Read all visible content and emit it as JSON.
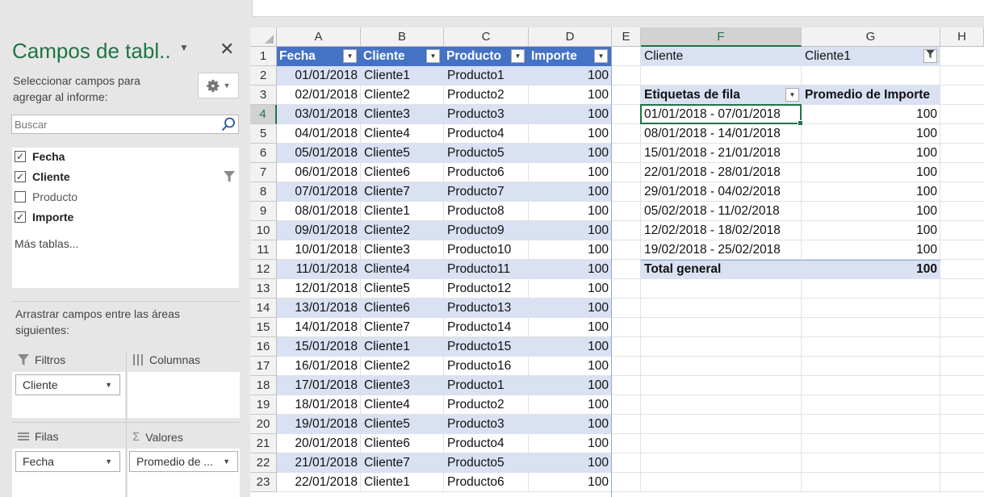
{
  "pane": {
    "title": "Campos de tabl..",
    "instructions": "Seleccionar campos para agregar al informe:",
    "search_placeholder": "Buscar",
    "fields": [
      {
        "label": "Fecha",
        "checked": true
      },
      {
        "label": "Cliente",
        "checked": true
      },
      {
        "label": "Producto",
        "checked": false
      },
      {
        "label": "Importe",
        "checked": true
      }
    ],
    "more_tables": "Más tablas...",
    "drag_instructions": "Arrastrar campos entre las áreas siguientes:",
    "areas": {
      "filters_label": "Filtros",
      "columns_label": "Columnas",
      "rows_label": "Filas",
      "values_label": "Valores",
      "filter_item": "Cliente",
      "row_item": "Fecha",
      "value_item": "Promedio de ..."
    }
  },
  "sheet": {
    "columns": [
      "A",
      "B",
      "C",
      "D",
      "E",
      "F",
      "G",
      "H"
    ],
    "selected_column": "F",
    "selected_row": 4,
    "rows": [
      1,
      2,
      3,
      4,
      5,
      6,
      7,
      8,
      9,
      10,
      11,
      12,
      13,
      14,
      15,
      16,
      17,
      18,
      19,
      20,
      21,
      22,
      23
    ],
    "table_headers": [
      "Fecha",
      "Cliente",
      "Producto",
      "Importe"
    ],
    "table_rows": [
      [
        "01/01/2018",
        "Cliente1",
        "Producto1",
        "100"
      ],
      [
        "02/01/2018",
        "Cliente2",
        "Producto2",
        "100"
      ],
      [
        "03/01/2018",
        "Cliente3",
        "Producto3",
        "100"
      ],
      [
        "04/01/2018",
        "Cliente4",
        "Producto4",
        "100"
      ],
      [
        "05/01/2018",
        "Cliente5",
        "Producto5",
        "100"
      ],
      [
        "06/01/2018",
        "Cliente6",
        "Producto6",
        "100"
      ],
      [
        "07/01/2018",
        "Cliente7",
        "Producto7",
        "100"
      ],
      [
        "08/01/2018",
        "Cliente1",
        "Producto8",
        "100"
      ],
      [
        "09/01/2018",
        "Cliente2",
        "Producto9",
        "100"
      ],
      [
        "10/01/2018",
        "Cliente3",
        "Producto10",
        "100"
      ],
      [
        "11/01/2018",
        "Cliente4",
        "Producto11",
        "100"
      ],
      [
        "12/01/2018",
        "Cliente5",
        "Producto12",
        "100"
      ],
      [
        "13/01/2018",
        "Cliente6",
        "Producto13",
        "100"
      ],
      [
        "14/01/2018",
        "Cliente7",
        "Producto14",
        "100"
      ],
      [
        "15/01/2018",
        "Cliente1",
        "Producto15",
        "100"
      ],
      [
        "16/01/2018",
        "Cliente2",
        "Producto16",
        "100"
      ],
      [
        "17/01/2018",
        "Cliente3",
        "Producto1",
        "100"
      ],
      [
        "18/01/2018",
        "Cliente4",
        "Producto2",
        "100"
      ],
      [
        "19/01/2018",
        "Cliente5",
        "Producto3",
        "100"
      ],
      [
        "20/01/2018",
        "Cliente6",
        "Producto4",
        "100"
      ],
      [
        "21/01/2018",
        "Cliente7",
        "Producto5",
        "100"
      ],
      [
        "22/01/2018",
        "Cliente1",
        "Producto6",
        "100"
      ]
    ]
  },
  "pivot": {
    "filter_field": "Cliente",
    "filter_value": "Cliente1",
    "row_header": "Etiquetas de fila",
    "value_header": "Promedio de Importe",
    "rows": [
      {
        "label": "01/01/2018 - 07/01/2018",
        "value": "100"
      },
      {
        "label": "08/01/2018 - 14/01/2018",
        "value": "100"
      },
      {
        "label": "15/01/2018 - 21/01/2018",
        "value": "100"
      },
      {
        "label": "22/01/2018 - 28/01/2018",
        "value": "100"
      },
      {
        "label": "29/01/2018 - 04/02/2018",
        "value": "100"
      },
      {
        "label": "05/02/2018 - 11/02/2018",
        "value": "100"
      },
      {
        "label": "12/02/2018 - 18/02/2018",
        "value": "100"
      },
      {
        "label": "19/02/2018 - 25/02/2018",
        "value": "100"
      }
    ],
    "total_label": "Total general",
    "total_value": "100"
  },
  "colors": {
    "accent": "#217346",
    "table_header": "#4472c4",
    "band": "#d9e1f2"
  }
}
